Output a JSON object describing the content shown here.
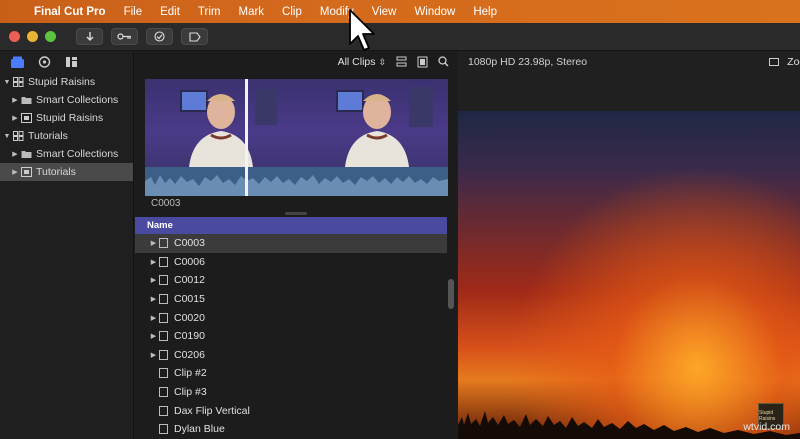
{
  "menubar": {
    "apple_icon": "apple-icon",
    "app_name": "Final Cut Pro",
    "items": [
      "File",
      "Edit",
      "Trim",
      "Mark",
      "Clip",
      "Modify",
      "View",
      "Window",
      "Help"
    ]
  },
  "toolbar": {
    "buttons": [
      "import-icon",
      "keyword-icon",
      "check-icon",
      "background-tasks-icon"
    ]
  },
  "sidebar": {
    "icons": [
      "libraries-icon",
      "photos-audio-icon",
      "titles-generators-icon"
    ],
    "items": [
      {
        "label": "Stupid Raisins",
        "level": 0,
        "type": "library"
      },
      {
        "label": "Smart Collections",
        "level": 1,
        "type": "folder"
      },
      {
        "label": "Stupid Raisins",
        "level": 1,
        "type": "event"
      },
      {
        "label": "Tutorials",
        "level": 0,
        "type": "library"
      },
      {
        "label": "Smart Collections",
        "level": 1,
        "type": "folder"
      },
      {
        "label": "Tutorials",
        "level": 1,
        "type": "event",
        "selected": true
      }
    ]
  },
  "browser": {
    "filter_label": "All Clips",
    "filmstrip_clip": "C0003",
    "column_name": "Name",
    "clips": [
      {
        "name": "C0003",
        "expandable": true,
        "selected": true
      },
      {
        "name": "C0006",
        "expandable": true
      },
      {
        "name": "C0012",
        "expandable": true
      },
      {
        "name": "C0015",
        "expandable": true
      },
      {
        "name": "C0020",
        "expandable": true
      },
      {
        "name": "C0190",
        "expandable": true
      },
      {
        "name": "C0206",
        "expandable": true
      },
      {
        "name": "Clip #2",
        "expandable": false
      },
      {
        "name": "Clip #3",
        "expandable": false
      },
      {
        "name": "Dax Flip Vertical",
        "expandable": false
      },
      {
        "name": "Dylan Blue",
        "expandable": false
      }
    ]
  },
  "viewer": {
    "format": "1080p HD 23.98p, Stereo",
    "zoom_label": "Zoom"
  },
  "watermark": "wtvid.com",
  "colors": {
    "menubar_accent": "#d36a1c",
    "list_header": "#4a4aa0",
    "waveform": "#3d5e86"
  }
}
